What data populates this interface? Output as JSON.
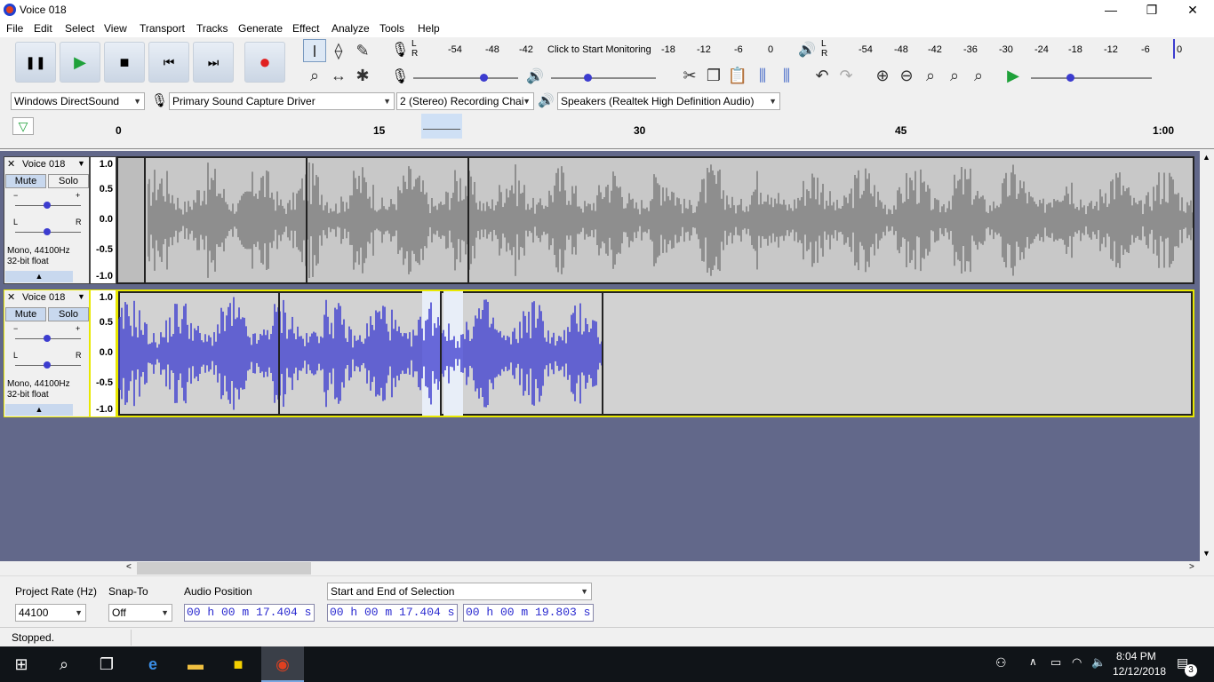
{
  "window": {
    "title": "Voice 018",
    "minimize": "—",
    "maximize": "❐",
    "close": "✕"
  },
  "menu": [
    "File",
    "Edit",
    "Select",
    "View",
    "Transport",
    "Tracks",
    "Generate",
    "Effect",
    "Analyze",
    "Tools",
    "Help"
  ],
  "transport": {
    "pause": "❚❚",
    "play": "▶",
    "stop": "■",
    "skip_start": "⏮",
    "skip_end": "⏭",
    "record": "●"
  },
  "meters": {
    "record_L": "L",
    "record_R": "R",
    "record_ticks": [
      "-54",
      "-48",
      "-42",
      "-18",
      "-12",
      "-6",
      "0"
    ],
    "monitor_prompt": "Click to Start Monitoring",
    "play_L": "L",
    "play_R": "R",
    "play_ticks": [
      "-54",
      "-48",
      "-42",
      "-36",
      "-30",
      "-24",
      "-18",
      "-12",
      "-6",
      "0"
    ]
  },
  "devices": {
    "host": "Windows DirectSound",
    "input": "Primary Sound Capture Driver",
    "channels": "2 (Stereo) Recording Chai",
    "output": "Speakers (Realtek High Definition Audio)"
  },
  "ruler": {
    "ticks": [
      "0",
      "15",
      "30",
      "45",
      "1:00"
    ]
  },
  "tracks": [
    {
      "name": "Voice 018",
      "mute": "Mute",
      "solo": "Solo",
      "gain_minus": "−",
      "gain_plus": "+",
      "pan_L": "L",
      "pan_R": "R",
      "format": "Mono, 44100Hz",
      "depth": "32-bit float",
      "scale": [
        "1.0",
        "0.5",
        "0.0",
        "-0.5",
        "-1.0"
      ],
      "wave_color": "#7a7a7a"
    },
    {
      "name": "Voice 018",
      "mute": "Mute",
      "solo": "Solo",
      "gain_minus": "−",
      "gain_plus": "+",
      "pan_L": "L",
      "pan_R": "R",
      "format": "Mono, 44100Hz",
      "depth": "32-bit float",
      "scale": [
        "1.0",
        "0.5",
        "0.0",
        "-0.5",
        "-1.0"
      ],
      "wave_color": "#3c3ccf"
    }
  ],
  "selection_bar": {
    "project_rate_label": "Project Rate (Hz)",
    "project_rate": "44100",
    "snap_label": "Snap-To",
    "snap": "Off",
    "audio_position_label": "Audio Position",
    "audio_position": "00 h 00 m 17.404 s",
    "selection_mode": "Start and End of Selection",
    "selection_start": "00 h 00 m 17.404 s",
    "selection_end": "00 h 00 m 19.803 s"
  },
  "status": "Stopped.",
  "taskbar": {
    "time": "8:04 PM",
    "date": "12/12/2018",
    "notifications": "3"
  },
  "colors": {
    "accent_blue": "#3c3ccf",
    "track_bg": "#62688a",
    "selected_border": "#e8e800"
  }
}
